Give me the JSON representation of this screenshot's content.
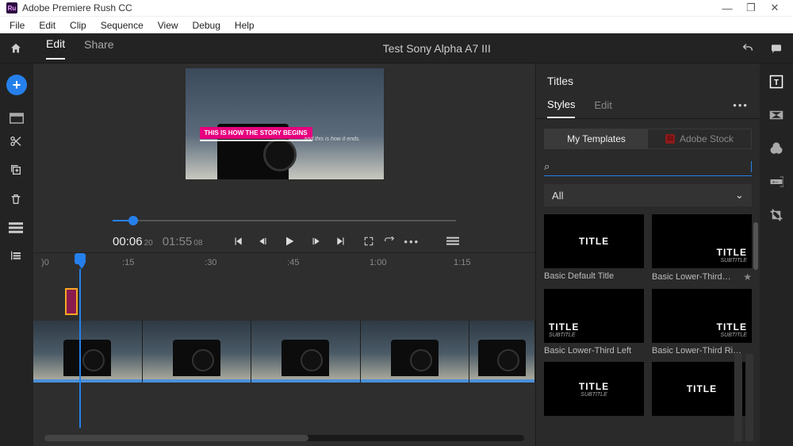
{
  "app": {
    "name": "Adobe Premiere Rush CC"
  },
  "menubar": [
    "File",
    "Edit",
    "Clip",
    "Sequence",
    "View",
    "Debug",
    "Help"
  ],
  "topnav": {
    "tabs": {
      "edit": "Edit",
      "share": "Share"
    },
    "project_title": "Test Sony Alpha A7 III"
  },
  "preview": {
    "title_text": "THIS IS HOW THE STORY BEGINS",
    "subtitle_text": "and this is how it ends."
  },
  "playback": {
    "current_time": "00:06",
    "current_frames": "20",
    "duration": "01:55",
    "duration_frames": "08"
  },
  "ruler": {
    "ticks": [
      {
        "label": ")0",
        "pos": 10
      },
      {
        "label": ":15",
        "pos": 112
      },
      {
        "label": ":30",
        "pos": 216
      },
      {
        "label": ":45",
        "pos": 320
      },
      {
        "label": "1:00",
        "pos": 424
      },
      {
        "label": "1:15",
        "pos": 530
      }
    ]
  },
  "titles_panel": {
    "heading": "Titles",
    "tabs": {
      "styles": "Styles",
      "edit": "Edit"
    },
    "sources": {
      "my": "My Templates",
      "stock": "Adobe Stock"
    },
    "search_placeholder": "",
    "filter": "All",
    "templates": [
      {
        "name": "Basic Default Title",
        "variant": "center",
        "lines": [
          "TITLE"
        ]
      },
      {
        "name": "Basic Lower-Third…",
        "variant": "br",
        "lines": [
          "TITLE",
          "SUBTITLE"
        ],
        "starred": true
      },
      {
        "name": "Basic Lower-Third Left",
        "variant": "tl",
        "lines": [
          "TITLE",
          "SUBTITLE"
        ]
      },
      {
        "name": "Basic Lower-Third Ri…",
        "variant": "br",
        "lines": [
          "TITLE",
          "SUBTITLE"
        ]
      },
      {
        "name": "",
        "variant": "center",
        "lines": [
          "TITLE",
          "SUBTITLE"
        ]
      },
      {
        "name": "",
        "variant": "center",
        "lines": [
          "TITLE"
        ]
      }
    ]
  }
}
